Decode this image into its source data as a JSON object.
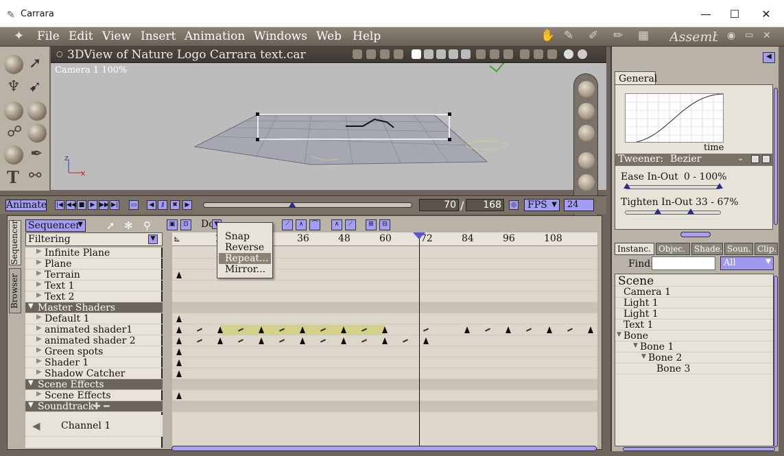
{
  "window": {
    "app_icon": "✎",
    "title": "Carrara",
    "minimize": "—",
    "maximize": "☐",
    "close": "✕"
  },
  "menu": {
    "items": [
      "File",
      "Edit",
      "View",
      "Insert",
      "Animation",
      "Windows",
      "Web",
      "Help"
    ],
    "mode": "Assembly"
  },
  "view": {
    "title": "3DView of Nature Logo Carrara text.car",
    "camera": "Camera 1 100%"
  },
  "animation": {
    "animate_label": "Animate",
    "current_frame": "70",
    "total_frames": "168",
    "separator": "/",
    "fps_label": "FPS",
    "fps_value": "24"
  },
  "sequencer": {
    "mode_select": "Sequencer",
    "side_tabs": [
      "Sequencer",
      "Browser"
    ],
    "filtering": "Filtering",
    "do_label": "Do",
    "ruler": [
      "12",
      "36",
      "48",
      "60",
      "72",
      "84",
      "96",
      "108"
    ],
    "tracks": [
      {
        "label": "Infinite Plane",
        "group": false,
        "keys": []
      },
      {
        "label": "Plane",
        "group": false,
        "keys": []
      },
      {
        "label": "Terrain",
        "group": false,
        "keys": [
          0
        ]
      },
      {
        "label": "Text 1",
        "group": false,
        "keys": []
      },
      {
        "label": "Text 2",
        "group": false,
        "keys": []
      },
      {
        "label": "Master Shaders",
        "group": true,
        "keys": []
      },
      {
        "label": "Default 1",
        "group": false,
        "keys": [
          0
        ]
      },
      {
        "label": "animated shader1",
        "group": false,
        "keys": [
          0,
          12,
          24,
          36,
          48,
          60,
          84,
          96,
          108,
          120,
          132,
          144
        ]
      },
      {
        "label": "animated shader 2",
        "group": false,
        "keys": [
          0,
          12,
          24,
          36,
          48,
          60,
          72
        ]
      },
      {
        "label": "Green spots",
        "group": false,
        "keys": [
          0
        ]
      },
      {
        "label": "Shader 1",
        "group": false,
        "keys": [
          0
        ]
      },
      {
        "label": "Shadow Catcher",
        "group": false,
        "keys": [
          0
        ]
      },
      {
        "label": "Scene Effects",
        "group": true,
        "keys": []
      },
      {
        "label": "Scene Effects",
        "group": false,
        "keys": [
          0
        ]
      },
      {
        "label": "Soundtrack",
        "group": true,
        "keys": []
      }
    ],
    "channel": "Channel 1",
    "dropdown": [
      "Snap",
      "Reverse",
      "Repeat...",
      "Mirror..."
    ],
    "dropdown_selected": "Repeat..."
  },
  "general": {
    "tab": "General",
    "time_label": "time",
    "tweener_label": "Tweener:",
    "tweener_value": "Bezier",
    "ease_label": "Ease In-Out",
    "ease_value": "0 - 100%",
    "tighten_label": "Tighten In-Out 33 - 67%"
  },
  "right_tabs": [
    "Instanc.",
    "Objec.",
    "Shade.",
    "Soun.",
    "Clip."
  ],
  "find": {
    "label": "Find:",
    "value": "",
    "select": "All"
  },
  "scene_tree": [
    {
      "label": "Scene",
      "indent": 0
    },
    {
      "label": "Camera 1",
      "indent": 1
    },
    {
      "label": "Light 1",
      "indent": 1
    },
    {
      "label": "Light 1",
      "indent": 1
    },
    {
      "label": "Text 1",
      "indent": 1
    },
    {
      "label": "Bone",
      "indent": 1
    },
    {
      "label": "Bone 1",
      "indent": 2
    },
    {
      "label": "Bone 2",
      "indent": 3
    },
    {
      "label": "Bone 3",
      "indent": 4
    }
  ],
  "colors": {
    "accent": "#a39df5",
    "panel": "#b8b2a7",
    "dark": "#3c3731"
  }
}
